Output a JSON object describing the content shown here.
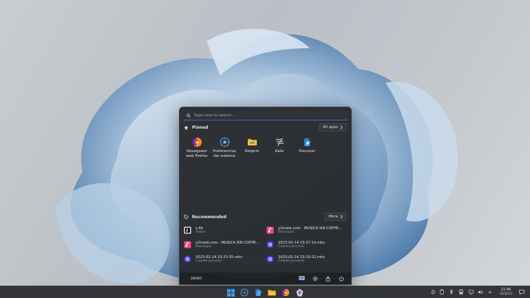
{
  "start_menu": {
    "search_placeholder": "Type here to search ...",
    "pinned_title": "Pinned",
    "all_apps_label": "All apps",
    "pinned": [
      {
        "label": "Navegador web Firefox",
        "icon": "firefox-icon"
      },
      {
        "label": "Preferencias del sistema",
        "icon": "system-settings-icon"
      },
      {
        "label": "Dolphin",
        "icon": "folder-icon"
      },
      {
        "label": "Kate",
        "icon": "kate-icon"
      },
      {
        "label": "Discover",
        "icon": "discover-icon"
      }
    ],
    "recommended_title": "Recommended",
    "more_label": "More",
    "recommended": [
      {
        "name": "s.flb",
        "location": "Vídeos",
        "icon": "video-file-icon"
      },
      {
        "name": "y2mate.com - MÚSICA SIN COPYR...",
        "location": "Descargas",
        "icon": "music-file-icon"
      },
      {
        "name": "y2mate.com - MÚSICA SIN COPYR...",
        "location": "Descargas",
        "icon": "music-file-icon"
      },
      {
        "name": "2023-02-14 23-27-14.mkv",
        "location": "Carpeta personal",
        "icon": "media-file-icon"
      },
      {
        "name": "2023-02-14 23-25-55.mkv",
        "location": "Carpeta personal",
        "icon": "media-file-icon"
      },
      {
        "name": "2023-02-14 23-20-32.mkv",
        "location": "Carpeta personal",
        "icon": "media-file-icon"
      }
    ],
    "user_name": "zaron"
  },
  "taskbar": {
    "time": "21:46",
    "date": "16/02/23"
  },
  "colors": {
    "accent": "#3d6fb0",
    "menu_bg": "#282a2d",
    "taskbar_bg": "#2d2f33"
  }
}
